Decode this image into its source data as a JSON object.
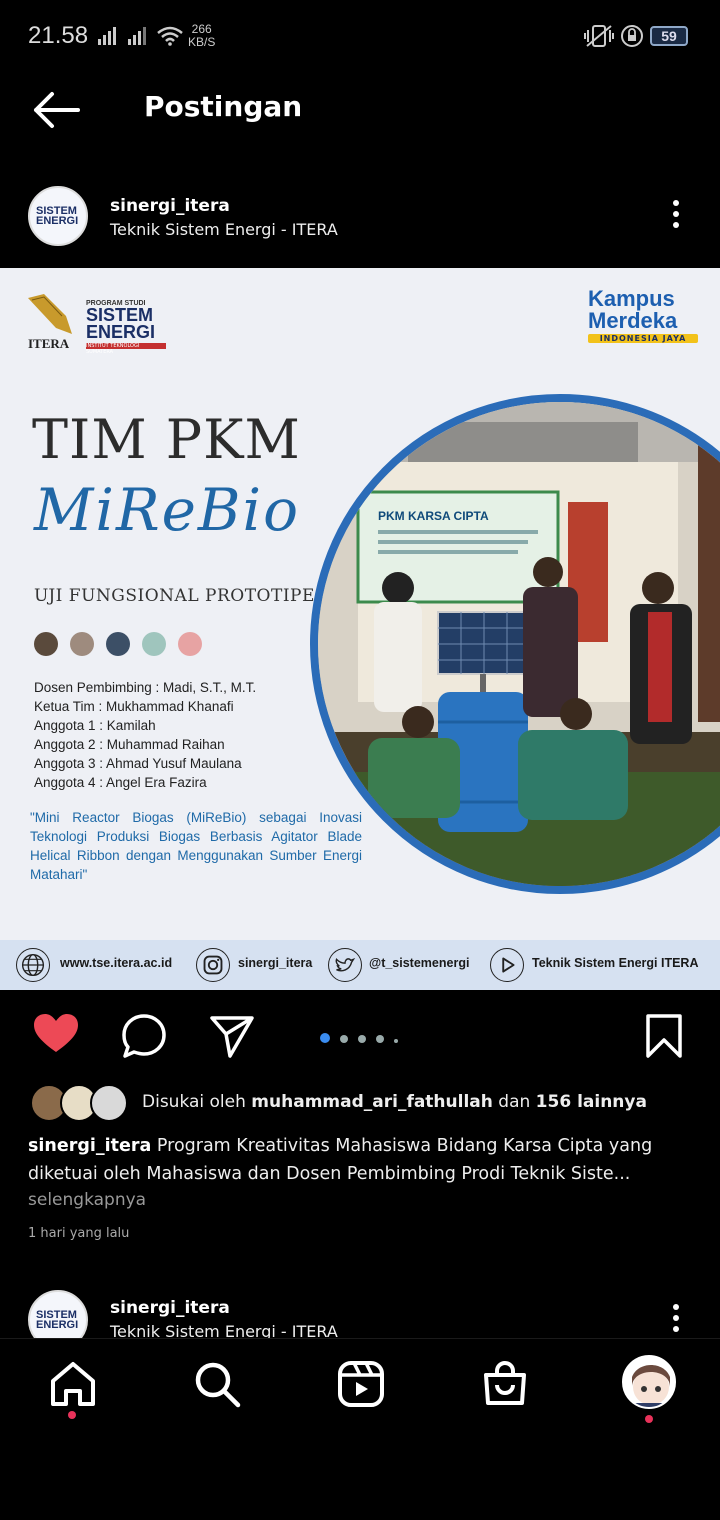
{
  "status_bar": {
    "time": "21.58",
    "net_speed_value": "266",
    "net_speed_unit": "KB/S",
    "battery": "59"
  },
  "nav": {
    "title": "Postingan"
  },
  "post": {
    "username": "sinergi_itera",
    "subtitle": "Teknik Sistem Energi - ITERA"
  },
  "image": {
    "itera_logo_text": "ITERA",
    "tse_logo": {
      "program": "PROGRAM STUDI",
      "line1": "SISTEM",
      "line2": "ENERGI",
      "institute": "INSTITUT TEKNOLOGI SUMATERA"
    },
    "kampus_merdeka": {
      "line1": "Kampus",
      "line2": "Merdeka",
      "tagline": "INDONESIA JAYA"
    },
    "title": "TIM PKM",
    "script_title": "MiReBio",
    "subtitle": "UJI FUNGSIONAL PROTOTIPE",
    "swatch_colors": [
      "#5a4a3c",
      "#9e8b7e",
      "#3c4f66",
      "#9fc5bd",
      "#e7a3a3"
    ],
    "team": [
      "Dosen Pembimbing : Madi, S.T., M.T.",
      "Ketua Tim : Mukhammad Khanafi",
      "Anggota 1 : Kamilah",
      "Anggota 2 : Muhammad Raihan",
      "Anggota 3 : Ahmad Yusuf Maulana",
      "Anggota 4 : Angel Era Fazira"
    ],
    "quote": "\"Mini Reactor Biogas (MiReBio) sebagai Inovasi Teknologi Produksi Biogas Berbasis Agitator Blade Helical Ribbon dengan Menggunakan Sumber Energi Matahari\"",
    "banner_text": "PKM KARSA CIPTA",
    "footer": {
      "website": "www.tse.itera.ac.id",
      "instagram": "sinergi_itera",
      "twitter": "@t_sistemenergi",
      "youtube": "Teknik Sistem Energi ITERA"
    }
  },
  "engagement": {
    "liked_by_prefix": "Disukai oleh ",
    "liked_by_user": "muhammad_ari_fathullah",
    "liked_by_mid": " dan ",
    "liked_by_count": "156 lainnya",
    "caption_user": "sinergi_itera",
    "caption_text": " Program Kreativitas Mahasiswa Bidang Karsa Cipta yang diketuai oleh Mahasiswa dan Dosen Pembimbing Prodi Teknik Siste...",
    "more_label": "selengkapnya",
    "time_ago": "1 hari yang lalu",
    "carousel_count": 5,
    "carousel_active": 0
  },
  "next_post": {
    "username": "sinergi_itera",
    "subtitle": "Teknik Sistem Energi - ITERA"
  },
  "icons": {
    "back": "arrow-left-icon",
    "more": "more-vertical-icon",
    "like": "heart-icon",
    "comment": "comment-icon",
    "share": "send-icon",
    "save": "bookmark-icon",
    "home": "home-icon",
    "search": "search-icon",
    "reels": "reels-icon",
    "shop": "shop-icon"
  },
  "colors": {
    "like": "#ed4956",
    "accent": "#3a8cf0",
    "notify": "#e8325a",
    "brand_blue": "#2067a6"
  }
}
